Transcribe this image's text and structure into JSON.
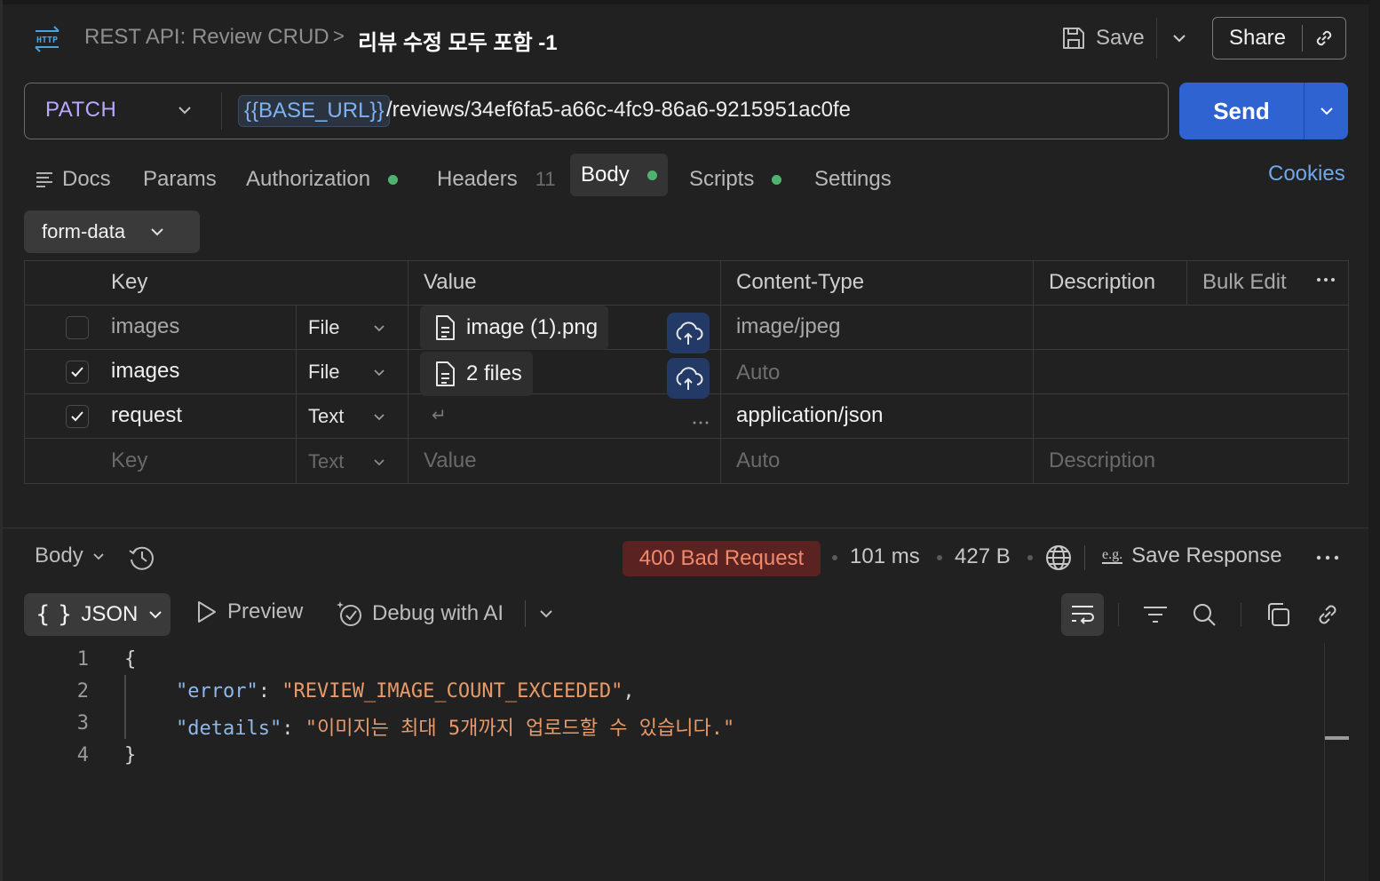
{
  "header": {
    "icon": "http-icon",
    "icon_text": "HTTP",
    "collection": "REST API: Review CRUD",
    "separator": ">",
    "request_name": "리뷰 수정 모두 포함 -1",
    "save_label": "Save",
    "share_label": "Share"
  },
  "urlbar": {
    "method": "PATCH",
    "variable": "{{BASE_URL}}",
    "path": "/reviews/34ef6fa5-a66c-4fc9-86a6-9215951ac0fe",
    "send_label": "Send"
  },
  "tabs": {
    "docs": "Docs",
    "params": "Params",
    "authorization": "Authorization",
    "headers": "Headers",
    "headers_count": "11",
    "body": "Body",
    "scripts": "Scripts",
    "settings": "Settings",
    "cookies": "Cookies",
    "dot_color": "#4fb36f"
  },
  "body_mode": "form-data",
  "table": {
    "columns": {
      "key": "Key",
      "value": "Value",
      "content_type": "Content-Type",
      "description": "Description",
      "bulk_edit": "Bulk Edit"
    },
    "rows": [
      {
        "checked": false,
        "key": "images",
        "type": "File",
        "value": "image (1).png",
        "content_type": "image/jpeg"
      },
      {
        "checked": true,
        "key": "images",
        "type": "File",
        "value": "2 files",
        "content_type": "Auto"
      },
      {
        "checked": true,
        "key": "request",
        "type": "Text",
        "value": "↵",
        "content_type": "application/json"
      }
    ],
    "placeholder_row": {
      "key": "Key",
      "type": "Text",
      "value": "Value",
      "content_type": "Auto",
      "description": "Description"
    }
  },
  "response": {
    "view": "Body",
    "status": "400 Bad Request",
    "time": "101 ms",
    "size": "427 B",
    "eg": "e.g.",
    "save_response": "Save Response",
    "format": "JSON",
    "format_icon": "{ }",
    "preview": "Preview",
    "debug": "Debug with AI",
    "status_color": "#5a2220",
    "lines": [
      "1",
      "2",
      "3",
      "4"
    ],
    "code": {
      "open": "{",
      "key1": "\"error\"",
      "val1": "\"REVIEW_IMAGE_COUNT_EXCEEDED\"",
      "key2": "\"details\"",
      "val2": "\"이미지는 최대 5개까지 업로드할 수 있습니다.\"",
      "close": "}"
    }
  }
}
